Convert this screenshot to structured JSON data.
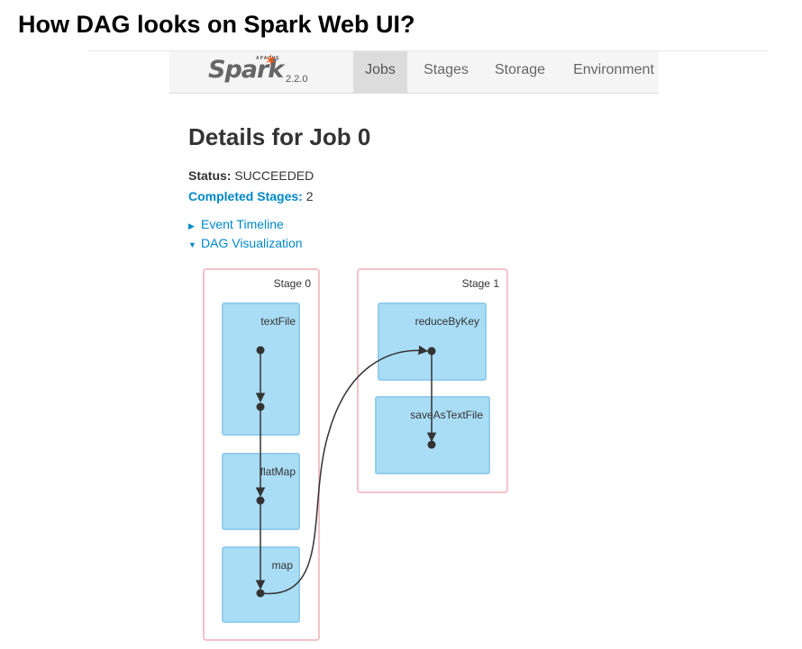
{
  "slide": {
    "title": "How DAG looks on Spark Web UI?"
  },
  "navbar": {
    "brand": {
      "apache": "APACHE",
      "name": "Spark",
      "version": "2.2.0"
    },
    "tabs": [
      {
        "label": "Jobs",
        "active": true
      },
      {
        "label": "Stages",
        "active": false
      },
      {
        "label": "Storage",
        "active": false
      },
      {
        "label": "Environment",
        "active": false
      }
    ]
  },
  "job": {
    "heading": "Details for Job 0",
    "status_label": "Status:",
    "status_value": "SUCCEEDED",
    "completed_label": "Completed Stages:",
    "completed_value": "2"
  },
  "toggles": {
    "event_timeline": "Event Timeline",
    "dag_visualization": "DAG Visualization"
  },
  "dag": {
    "stages": [
      {
        "label": "Stage 0",
        "operations": [
          "textFile",
          "flatMap",
          "map"
        ]
      },
      {
        "label": "Stage 1",
        "operations": [
          "reduceByKey",
          "saveAsTextFile"
        ]
      }
    ]
  },
  "colors": {
    "stage_border": "#f4c2c8",
    "op_fill": "#a9dcf5",
    "link": "#0088cc",
    "edge": "#333333"
  }
}
